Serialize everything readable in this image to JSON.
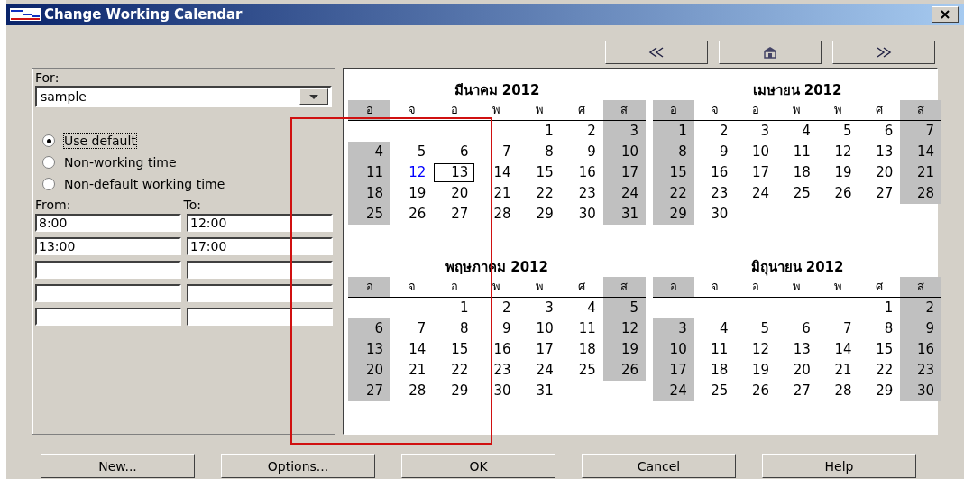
{
  "window": {
    "title": "Change Working Calendar"
  },
  "nav_buttons": [
    {
      "kind": "prev"
    },
    {
      "kind": "home"
    },
    {
      "kind": "next"
    }
  ],
  "for_field": {
    "label": "For:",
    "value": "sample"
  },
  "options": [
    {
      "label": "Use default",
      "selected": true
    },
    {
      "label": "Non-working time",
      "selected": false
    },
    {
      "label": "Non-default working time",
      "selected": false
    }
  ],
  "times": {
    "from_label": "From:",
    "to_label": "To:",
    "rows": [
      {
        "kind": "entry",
        "from": "8:00",
        "to": "12:00"
      },
      {
        "kind": "entry",
        "from": "13:00",
        "to": "17:00"
      },
      {
        "kind": "blank"
      },
      {
        "kind": "blank"
      },
      {
        "kind": "blank"
      }
    ]
  },
  "months": [
    {
      "title": "มีนาคม 2012",
      "weekdays": [
        "อ",
        "จ",
        "อ",
        "พ",
        "พ",
        "ศ",
        "ส"
      ],
      "weeks": [
        {
          "kind": "first",
          "days": [
            "1",
            "2",
            "3"
          ]
        },
        {
          "kind": "full",
          "days": [
            "4",
            "5",
            "6",
            "7",
            "8",
            "9",
            "10"
          ]
        },
        {
          "kind": "full",
          "days": [
            "11",
            {
              "day": "12",
              "kind": "today"
            },
            {
              "day": "13",
              "kind": "selected"
            },
            "14",
            "15",
            "16",
            "17"
          ]
        },
        {
          "kind": "full",
          "days": [
            "18",
            "19",
            "20",
            "21",
            "22",
            "23",
            "24"
          ]
        },
        {
          "kind": "full",
          "days": [
            "25",
            "26",
            "27",
            "28",
            "29",
            "30",
            "31"
          ]
        }
      ]
    },
    {
      "title": "เมษายน 2012",
      "weekdays": [
        "อ",
        "จ",
        "อ",
        "พ",
        "พ",
        "ศ",
        "ส"
      ],
      "weeks": [
        {
          "kind": "full",
          "days": [
            "1",
            "2",
            "3",
            "4",
            "5",
            "6",
            "7"
          ]
        },
        {
          "kind": "full",
          "days": [
            "8",
            "9",
            "10",
            "11",
            "12",
            "13",
            "14"
          ]
        },
        {
          "kind": "full",
          "days": [
            "15",
            "16",
            "17",
            "18",
            "19",
            "20",
            "21"
          ]
        },
        {
          "kind": "full",
          "days": [
            "22",
            "23",
            "24",
            "25",
            "26",
            "27",
            "28"
          ]
        },
        {
          "kind": "last",
          "days": [
            "29",
            "30"
          ]
        }
      ]
    },
    {
      "title": "พฤษภาคม 2012",
      "weekdays": [
        "อ",
        "จ",
        "อ",
        "พ",
        "พ",
        "ศ",
        "ส"
      ],
      "weeks": [
        {
          "kind": "first",
          "days": [
            "1",
            "2",
            "3",
            "4",
            "5"
          ]
        },
        {
          "kind": "full",
          "days": [
            "6",
            "7",
            "8",
            "9",
            "10",
            "11",
            "12"
          ]
        },
        {
          "kind": "full",
          "days": [
            "13",
            "14",
            "15",
            "16",
            "17",
            "18",
            "19"
          ]
        },
        {
          "kind": "full",
          "days": [
            "20",
            "21",
            "22",
            "23",
            "24",
            "25",
            "26"
          ]
        },
        {
          "kind": "last",
          "days": [
            "27",
            "28",
            "29",
            "30",
            "31"
          ]
        }
      ]
    },
    {
      "title": "มิถุนายน 2012",
      "weekdays": [
        "อ",
        "จ",
        "อ",
        "พ",
        "พ",
        "ศ",
        "ส"
      ],
      "weeks": [
        {
          "kind": "first",
          "days": [
            "1",
            "2"
          ]
        },
        {
          "kind": "full",
          "days": [
            "3",
            "4",
            "5",
            "6",
            "7",
            "8",
            "9"
          ]
        },
        {
          "kind": "full",
          "days": [
            "10",
            "11",
            "12",
            "13",
            "14",
            "15",
            "16"
          ]
        },
        {
          "kind": "full",
          "days": [
            "17",
            "18",
            "19",
            "20",
            "21",
            "22",
            "23"
          ]
        },
        {
          "kind": "full",
          "days": [
            "24",
            "25",
            "26",
            "27",
            "28",
            "29",
            "30"
          ]
        }
      ]
    }
  ],
  "buttons": [
    "New...",
    "Options...",
    "OK",
    "Cancel",
    "Help"
  ]
}
